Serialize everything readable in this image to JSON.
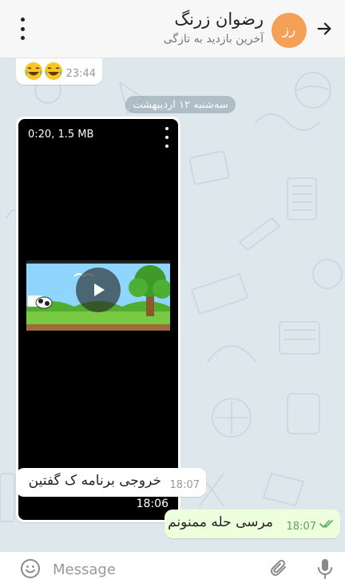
{
  "header": {
    "contact_name": "رضوان زرنگ",
    "status": "آخرین بازدید به تازگی",
    "avatar_initials": "رز",
    "avatar_color": "#f5a057"
  },
  "messages": {
    "emoji_message": {
      "emojis": [
        "face-with-tears-of-joy",
        "face-with-tears-of-joy"
      ],
      "time": "23:44"
    },
    "date_separator": "سه‌شنبه ۱۲ اردیبهشت",
    "video_message": {
      "meta": "0:20, 1.5 MB",
      "duration": "18:06"
    },
    "incoming_text": {
      "text": "خروجی برنامه ک گفتین",
      "time": "18:07"
    },
    "outgoing_text": {
      "text": "مرسی حله ممنونم",
      "time": "18:07",
      "status": "read"
    }
  },
  "composer": {
    "placeholder": "Message"
  },
  "colors": {
    "chat_background": "#dde7ec",
    "outgoing_bubble": "#eeffde",
    "read_ticks": "#5aa55a"
  }
}
